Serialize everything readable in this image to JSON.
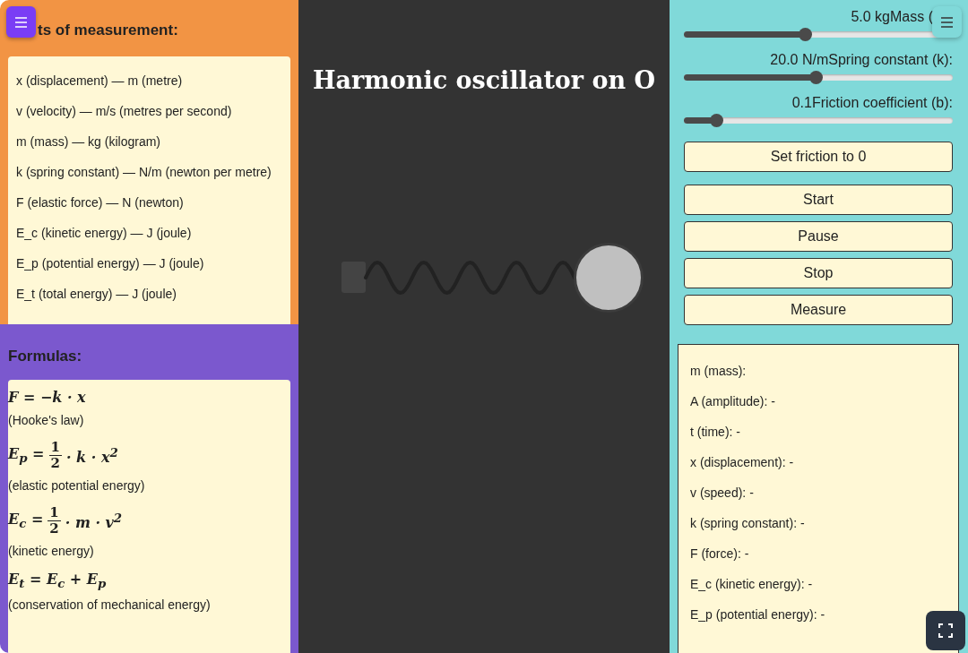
{
  "units": {
    "heading": "ts of measurement:",
    "items": [
      "x (displacement) — m (metre)",
      "v (velocity) — m/s (metres per second)",
      "m (mass) — kg (kilogram)",
      "k (spring constant) — N/m (newton per metre)",
      "F (elastic force) — N (newton)",
      "E_c (kinetic energy) — J (joule)",
      "E_p (potential energy) — J (joule)",
      "E_t (total energy) — J (joule)"
    ]
  },
  "formulas": {
    "heading": "Formulas:",
    "items": [
      {
        "kind": "plain",
        "expr": "F = −k · x",
        "caption": "(Hooke's law)"
      },
      {
        "kind": "fraction",
        "lhs": "E$_{p}$ =",
        "numerator": "1",
        "denominator": "2",
        "rhs": "· k · x$^{2}$",
        "caption": "(elastic potential energy)"
      },
      {
        "kind": "fraction",
        "lhs": "E$_{c}$ =",
        "numerator": "1",
        "denominator": "2",
        "rhs": "· m · v$^{2}$",
        "caption": "(kinetic energy)"
      },
      {
        "kind": "plain",
        "expr": "E$_{t}$ = E$_{c}$ + E$_{p}$",
        "caption": "(conservation of mechanical energy)"
      }
    ]
  },
  "title": "Harmonic oscillator on O",
  "controls": {
    "sliders": [
      {
        "value": "5.0 kg",
        "label": "Mass (",
        "level": 0.45
      },
      {
        "value": "20.0 N/m",
        "label": "Spring constant (k):",
        "level": 0.49
      },
      {
        "value": "0.1",
        "label": "Friction coefficient (b):",
        "level": 0.12
      }
    ],
    "buttons": [
      "Set friction to 0",
      "Start",
      "Pause",
      "Stop",
      "Measure"
    ]
  },
  "measurements": [
    "m (mass):",
    "A (amplitude): -",
    "t (time): -",
    "x (displacement): -",
    "v (speed): -",
    "k (spring constant): -",
    "F (force): -",
    "E_c (kinetic energy): -",
    "E_p (potential energy): -"
  ]
}
